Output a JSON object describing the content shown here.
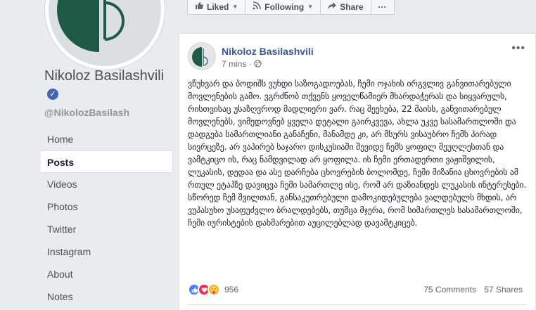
{
  "page": {
    "name": "Nikoloz Basilashvili",
    "verified_mark": "✓",
    "handle": "@NikolozBasilash"
  },
  "nav": [
    {
      "label": "Home"
    },
    {
      "label": "Posts",
      "active": true
    },
    {
      "label": "Videos"
    },
    {
      "label": "Photos"
    },
    {
      "label": "Twitter"
    },
    {
      "label": "Instagram"
    },
    {
      "label": "About"
    },
    {
      "label": "Notes"
    }
  ],
  "actions": {
    "liked": "Liked",
    "following": "Following",
    "share": "Share",
    "more": "···"
  },
  "post": {
    "author": "Nikoloz Basilashvili",
    "time": "7 mins",
    "separator": "·",
    "privacy_icon": "globe-icon",
    "text": "ვწუხვარ და ბოდიშს ვუხდი საზოგადოებას, ჩემი ოჯახის ირგვლივ განვითარებული მოვლენების გამო. ვგრძნობ თქვენს ყოველწამიერ მხარდაჭერას და სიყვარულს, რისთვისაც უსაზღვროდ მადლიერი ვარ. რაც შეეხება, 22 მაისს, განვითარებულ მოვლენებს, ვიმედოვნებ ყველა დეტალი გაირკვევა, ახლა უკვე სასამართლოში და დადგება სამართლიანი განაჩენი, მანამდე კი, არ მსურს ვისაუბრო ჩემს პირად სივრცეზე. არ ვაპირებ საჯარო დისკუსიაში შევიდე ჩემს ყოფილ მეუღლესთან და ვამტკიცო ის, რაც ნამდვილად არ ყოფილა. ის ჩემი ერთადერთი ვაჟიშვილის, ლუკასის, დედაა და ასე დარჩება ცხოვრების ბოლომდე, ჩემი მიზანია ცხოვრების ამ რთულ ეტაპზე დავიცვა ჩემი სამართლე ისე, რომ არ დაზიანდეს ლუკასის ინტერესები. სწორედ ჩემ შვილთან, განსაკუთრებული დამოკიდებულება ვალდებულს მხდის, არ ვუპასუხო უსაფუძვლო ბრალდებებს, თუმცა მჯერა, რომ სიმართლეს სასამართლოში, ჩემი იურისტების დახმარებით აუცილებლად დავამტკიცებ.",
    "reaction_count": "956",
    "comments": "75 Comments",
    "shares": "57 Shares"
  },
  "colors": {
    "link_blue": "#385898",
    "fb_blue": "#4267b2",
    "logo_green": "#1e5a45"
  }
}
